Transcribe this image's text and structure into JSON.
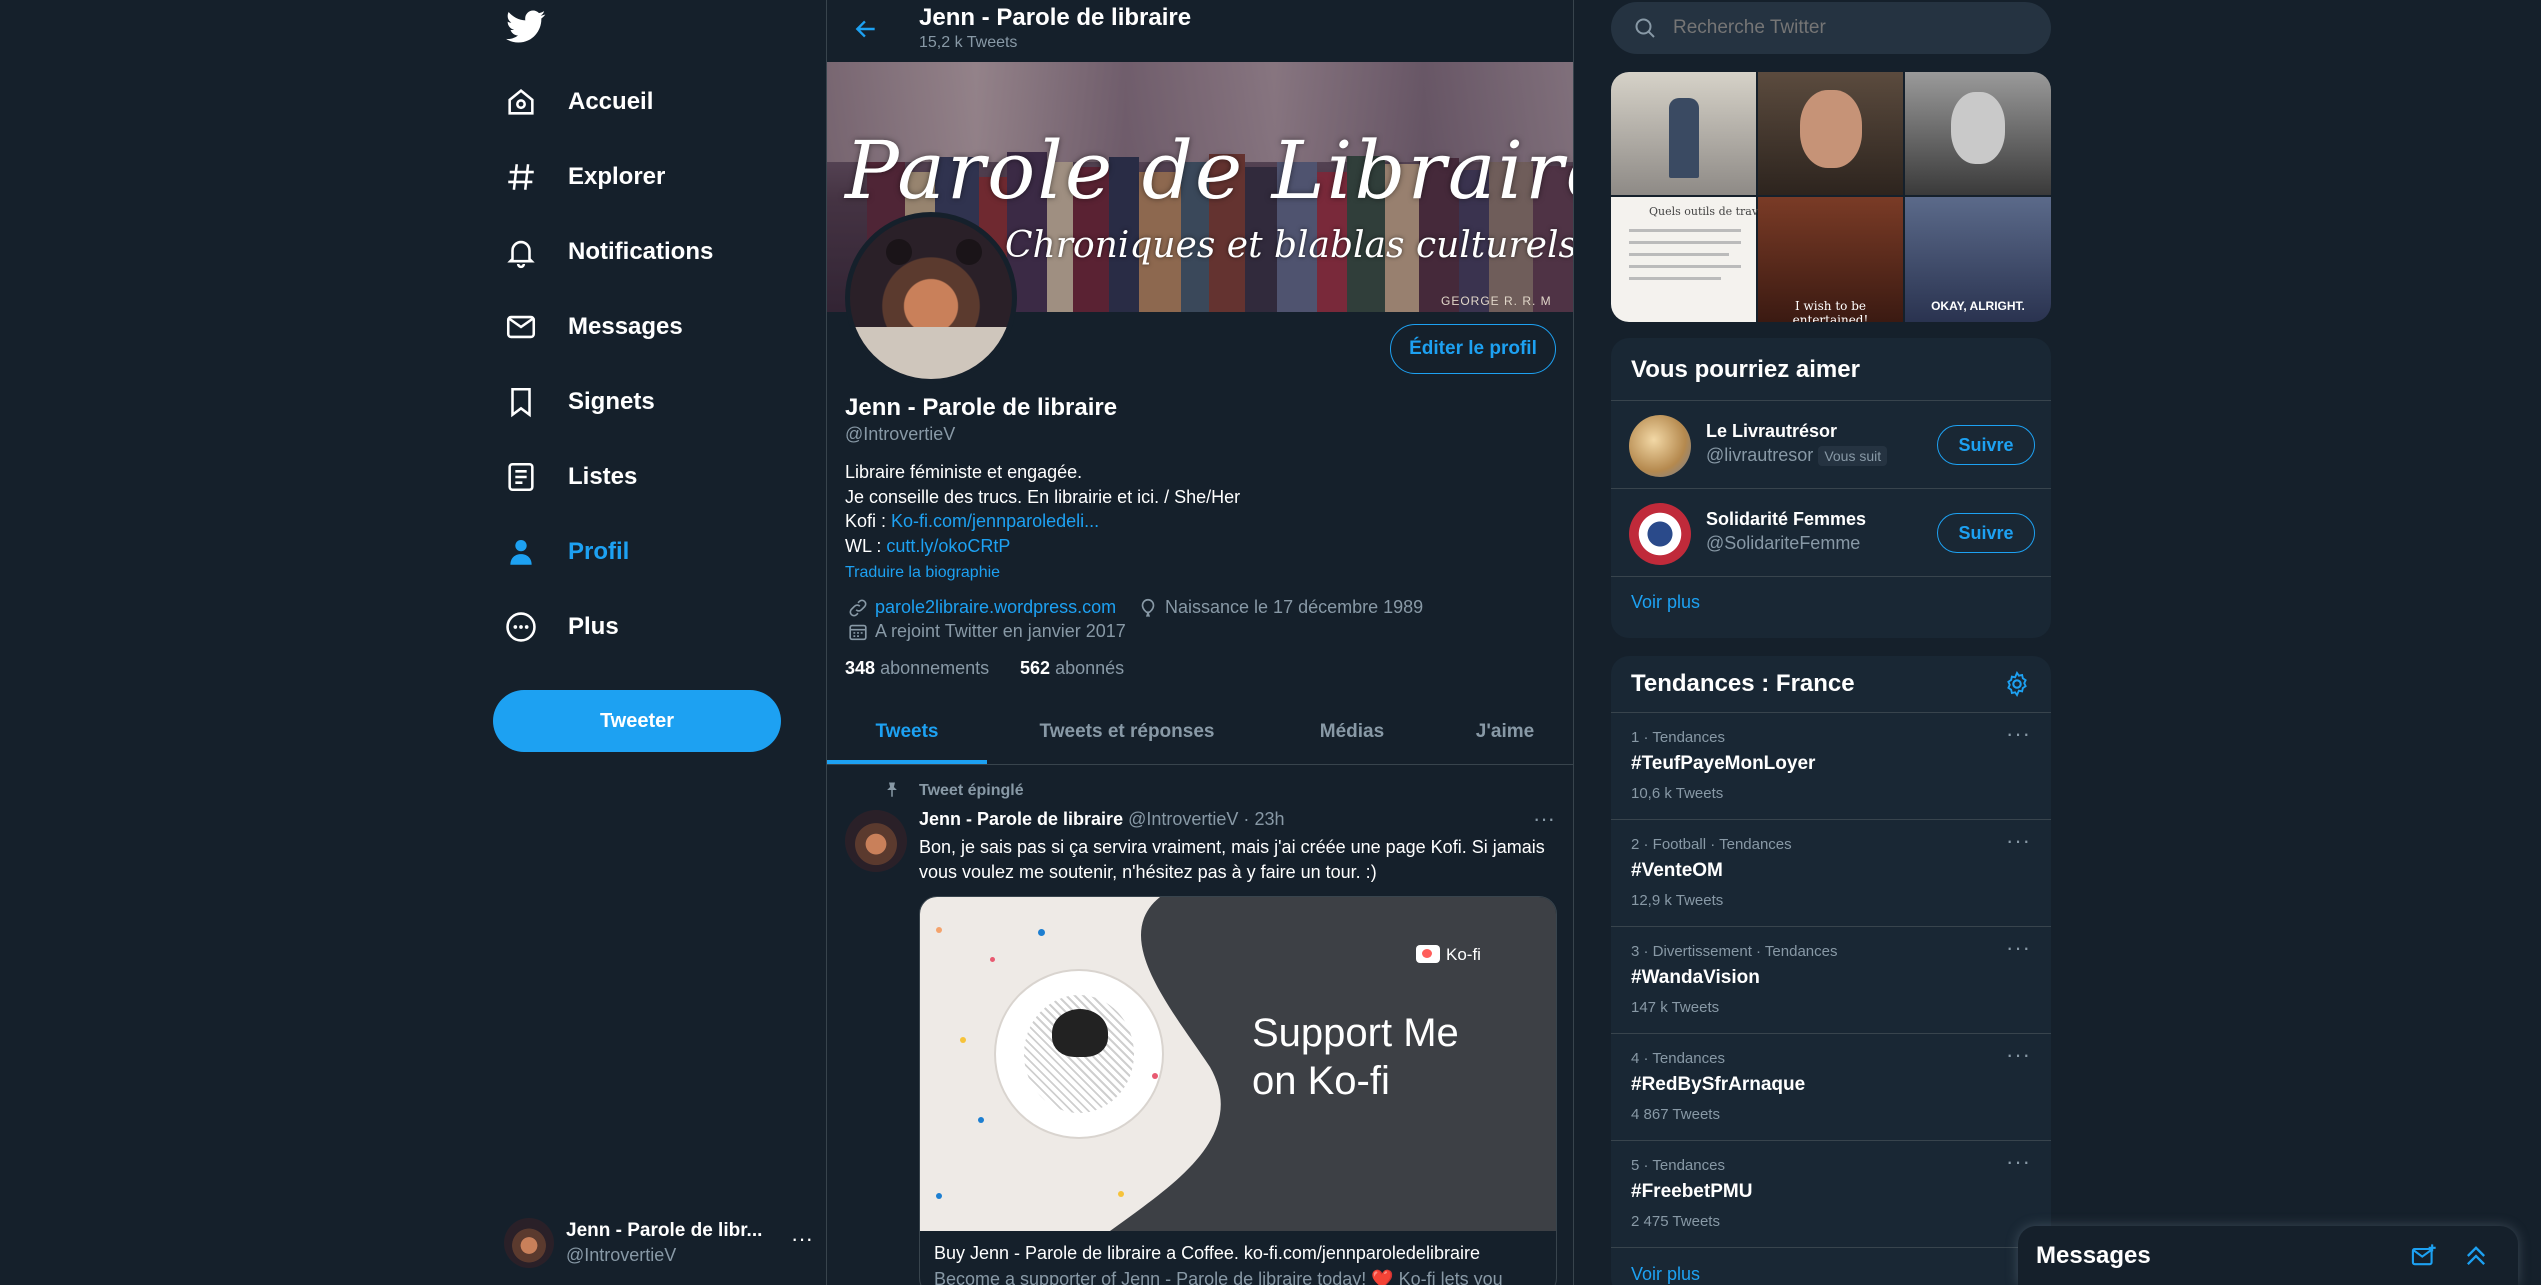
{
  "nav": {
    "items": [
      {
        "label": "Accueil",
        "icon": "home-icon"
      },
      {
        "label": "Explorer",
        "icon": "hashtag-icon"
      },
      {
        "label": "Notifications",
        "icon": "bell-icon"
      },
      {
        "label": "Messages",
        "icon": "envelope-icon"
      },
      {
        "label": "Signets",
        "icon": "bookmark-icon"
      },
      {
        "label": "Listes",
        "icon": "list-icon"
      },
      {
        "label": "Profil",
        "icon": "person-icon",
        "active": true
      },
      {
        "label": "Plus",
        "icon": "more-circle-icon"
      }
    ],
    "tweet_button": "Tweeter",
    "account": {
      "name": "Jenn - Parole de libr...",
      "handle": "@IntrovertieV"
    }
  },
  "header": {
    "title": "Jenn - Parole de libraire",
    "subtitle": "15,2 k Tweets"
  },
  "banner": {
    "title": "Parole de Libraire",
    "subtitle": "Chroniques et blablas culturels",
    "spine_text": "GEORGE R. R. M"
  },
  "profile": {
    "edit_button": "Éditer le profil",
    "name": "Jenn - Parole de libraire",
    "handle": "@IntrovertieV",
    "bio_line1": "Libraire féministe et engagée.",
    "bio_line2": "Je conseille des trucs. En librairie et ici. / She/Her",
    "kofi_label": "Kofi : ",
    "kofi_link": "Ko-fi.com/jennparoledeli...",
    "wl_label": "WL : ",
    "wl_link": "cutt.ly/okoCRtP",
    "translate": "Traduire la biographie",
    "website": "parole2libraire.wordpress.com",
    "birthday": "Naissance le 17 décembre 1989",
    "joined": "A rejoint Twitter en janvier 2017",
    "following_count": "348",
    "following_label": "abonnements",
    "followers_count": "562",
    "followers_label": "abonnés"
  },
  "tabs": [
    "Tweets",
    "Tweets et réponses",
    "Médias",
    "J'aime"
  ],
  "pinned_tweet": {
    "pinned_label": "Tweet épinglé",
    "author": "Jenn - Parole de libraire",
    "handle": "@IntrovertieV",
    "time": "23h",
    "text_line1": "Bon, je sais pas si ça servira vraiment, mais j'ai créée une page Kofi. Si jamais",
    "text_line2": "vous voulez me soutenir, n'hésitez pas à y faire un tour. :)",
    "card": {
      "brand": "Ko-fi",
      "headline_line1": "Support Me",
      "headline_line2": "on Ko-fi",
      "title": "Buy Jenn - Parole de libraire a Coffee. ko-fi.com/jennparoledelibraire",
      "desc": "Become a supporter of Jenn - Parole de libraire today! ❤️ Ko-fi lets you"
    }
  },
  "search": {
    "placeholder": "Recherche Twitter"
  },
  "media_grid": {
    "captions": [
      "I wish to be entertained!",
      "OKAY, ALRIGHT."
    ],
    "doc_text": "Quels outils de travail"
  },
  "who_to_follow": {
    "title": "Vous pourriez aimer",
    "users": [
      {
        "name": "Le Livrautrésor",
        "handle": "@livrautresor",
        "badge": "Vous suit",
        "button": "Suivre"
      },
      {
        "name": "Solidarité Femmes",
        "handle": "@SolidariteFemme",
        "badge": "",
        "button": "Suivre"
      }
    ],
    "more": "Voir plus"
  },
  "trends": {
    "title": "Tendances : France",
    "items": [
      {
        "meta": "1 · Tendances",
        "name": "#TeufPayeMonLoyer",
        "count": "10,6 k Tweets"
      },
      {
        "meta": "2 · Football · Tendances",
        "name": "#VenteOM",
        "count": "12,9 k Tweets"
      },
      {
        "meta": "3 · Divertissement · Tendances",
        "name": "#WandaVision",
        "count": "147 k Tweets"
      },
      {
        "meta": "4 · Tendances",
        "name": "#RedBySfrArnaque",
        "count": "4 867 Tweets"
      },
      {
        "meta": "5 · Tendances",
        "name": "#FreebetPMU",
        "count": "2 475 Tweets"
      }
    ],
    "more": "Voir plus"
  },
  "messages_drawer": {
    "title": "Messages"
  },
  "colors": {
    "background": "#15202b",
    "panel": "#192734",
    "accent": "#1da1f2",
    "muted": "#8899a6",
    "border": "#38444d"
  }
}
